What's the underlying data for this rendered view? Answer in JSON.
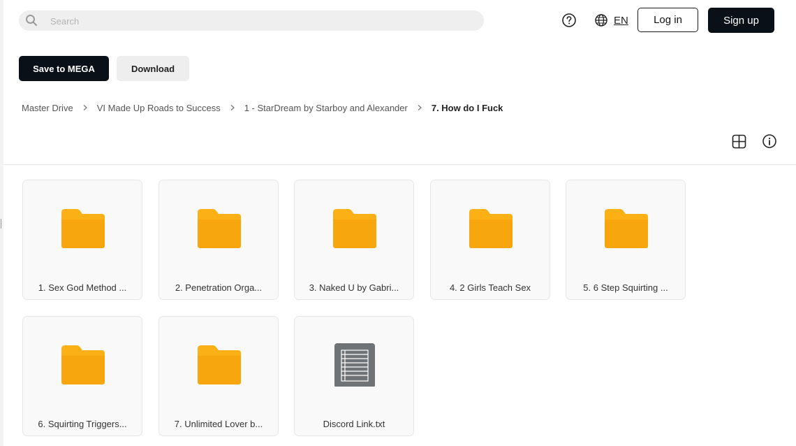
{
  "header": {
    "search_placeholder": "Search",
    "help_icon": "help-circle-icon",
    "language_icon": "globe-icon",
    "language": "EN",
    "login_label": "Log in",
    "signup_label": "Sign up"
  },
  "actions": {
    "save_label": "Save to MEGA",
    "download_label": "Download"
  },
  "breadcrumb": {
    "items": [
      "Master Drive",
      "VI Made Up Roads to Success",
      "1 - StarDream by Starboy and Alexander"
    ],
    "current": "7. How do I Fuck"
  },
  "view_controls": {
    "grid_icon": "grid-view-icon",
    "info_icon": "info-icon"
  },
  "items": [
    {
      "name": "1. Sex God Method ...",
      "type": "folder"
    },
    {
      "name": "2. Penetration Orga...",
      "type": "folder"
    },
    {
      "name": "3. Naked U by Gabri...",
      "type": "folder"
    },
    {
      "name": "4. 2 Girls Teach Sex",
      "type": "folder"
    },
    {
      "name": "5. 6 Step Squirting ...",
      "type": "folder"
    },
    {
      "name": "6. Squirting Triggers...",
      "type": "folder"
    },
    {
      "name": "7. Unlimited Lover b...",
      "type": "folder"
    },
    {
      "name": "Discord Link.txt",
      "type": "text-file"
    }
  ],
  "colors": {
    "folder": "#fbb116",
    "folder_dark": "#f59f00",
    "text_file": "#6e7378",
    "primary_button": "#0a1017"
  }
}
